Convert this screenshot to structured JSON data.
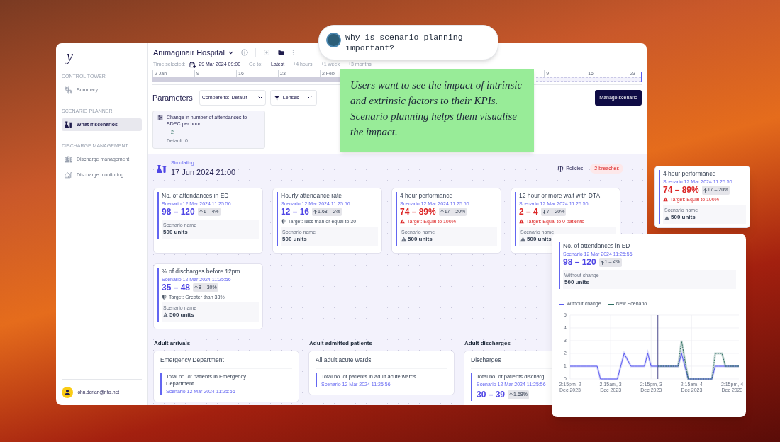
{
  "bubble": {
    "text": "Why is scenario planning important?"
  },
  "note": {
    "text": "Users want to see the impact of intrinsic and extrinsic factors to their KPIs. Scenario planning helps them visualise the impact."
  },
  "sidebar": {
    "logo": "y",
    "sections": [
      {
        "heading": "CONTROL TOWER",
        "items": [
          {
            "label": "Summary",
            "selected": false
          }
        ]
      },
      {
        "heading": "SCENARIO PLANNER",
        "items": [
          {
            "label": "What if scenarios",
            "selected": true
          }
        ]
      },
      {
        "heading": "DISCHARGE MANAGEMENT",
        "items": [
          {
            "label": "Discharge management",
            "selected": false
          },
          {
            "label": "Discharge monitoring",
            "selected": false
          }
        ]
      }
    ],
    "user": {
      "email": "john.dorian@nhs.net"
    }
  },
  "header": {
    "hospital": "Animaginair Hospital"
  },
  "time_bar": {
    "label": "Time selected:",
    "date": "29 Mar 2024 09:00",
    "goto_label": "Go to:",
    "goto_options": [
      {
        "label": "Latest",
        "selected": true
      },
      {
        "label": "+4 hours",
        "selected": false
      },
      {
        "label": "+1 week",
        "selected": false
      },
      {
        "label": "+3 months",
        "selected": false
      }
    ]
  },
  "timeline": {
    "ticks_start": [
      "2 Jan",
      "9",
      "16",
      "23",
      "2 Feb"
    ],
    "ticks_end": [
      "9",
      "16",
      "23"
    ]
  },
  "parameters": {
    "title": "Parameters",
    "compare": {
      "label": "Compare to:",
      "value": "Default"
    },
    "lenses": "Lenses",
    "manage_button": "Manage scenario",
    "items": [
      {
        "label": "Change in number of attendances to SDEC per hour",
        "value": "2",
        "default": "Default: 0"
      }
    ]
  },
  "simulation": {
    "status": "Simulating",
    "date": "17 Jun 2024 21:00",
    "policies": "Policies",
    "breaches": "2 breaches"
  },
  "kpi_cards": [
    {
      "title": "No. of attendances in ED",
      "scenario": "Scenario 12 Mar 2024 11:25:56",
      "value": "98 – 120",
      "breach": false,
      "delta": {
        "down": false,
        "text": "1 – 4%"
      },
      "unit_label": "Scenario name",
      "unit_value": "500 units",
      "warning": false
    },
    {
      "title": "Hourly attendance rate",
      "scenario": "Scenario 12 Mar 2024 11:25:56",
      "value": "12 – 16",
      "breach": false,
      "delta": {
        "down": false,
        "text": "1.68 – 2%"
      },
      "target": {
        "text": "Target: less than or equal to 30",
        "breach": false
      },
      "unit_label": "Scenario name",
      "unit_value": "500 units",
      "warning": false
    },
    {
      "title": "4 hour performance",
      "scenario": "Scenario 12 Mar 2024 11:25:56",
      "value": "74 – 89%",
      "breach": true,
      "delta": {
        "down": false,
        "text": "17 – 20%"
      },
      "target": {
        "text": "Target: Equal to 100%",
        "breach": true
      },
      "unit_label": "Scenario name",
      "unit_value": "500 units",
      "warning": true
    },
    {
      "title": "12 hour or more wait with DTA",
      "scenario": "Scenario 12 Mar 2024 11:25:56",
      "value": "2 – 4",
      "breach": true,
      "delta": {
        "down": true,
        "text": "7 – 20%"
      },
      "target": {
        "text": "Target: Equal to 0 patients",
        "breach": true
      },
      "unit_label": "Scenario name",
      "unit_value": "500 units",
      "warning": true
    },
    {
      "title": "% of discharges before 12pm",
      "scenario": "Scenario 12 Mar 2024 11:25:56",
      "value": "35 – 48",
      "breach": false,
      "delta": {
        "down": false,
        "text": "8 – 30%"
      },
      "target": {
        "text": "Target: Greater than 33%",
        "breach": false
      },
      "unit_label": "Scenario name",
      "unit_value": "500 units",
      "warning": true
    }
  ],
  "sections": [
    {
      "title": "Adult arrivals",
      "card": {
        "title": "Emergency Department",
        "metric": "Total no. of patients in Emergency Department",
        "scenario": "Scenario 12 Mar 2024 11:25:56"
      }
    },
    {
      "title": "Adult admitted patients",
      "card": {
        "title": "All adult acute wards",
        "metric": "Total no. of patients in adult acute wards",
        "scenario": "Scenario 12 Mar 2024 11:25:56"
      }
    },
    {
      "title": "Adult discharges",
      "card": {
        "title": "Discharges",
        "metric": "Total no. of patients discharg",
        "scenario": "Scenario 12 Mar 2024 11:25:56",
        "value": "30 – 39",
        "delta": {
          "down": false,
          "text": "1.68%"
        }
      }
    }
  ],
  "floating_kpi": {
    "title": "4 hour performance",
    "scenario": "Scenario 12 Mar 2024 11:25:56",
    "value": "74 – 89%",
    "breach": true,
    "delta": {
      "down": false,
      "text": "17 – 20%"
    },
    "target": {
      "text": "Target: Equal to 100%",
      "breach": true
    },
    "unit_label": "Scenario name",
    "unit_value": "500 units",
    "warning": true
  },
  "chart_card": {
    "kpi": {
      "title": "No. of attendances in ED",
      "scenario": "Scenario 12 Mar 2024 11:25:56",
      "value": "98 – 120",
      "breach": false,
      "delta": {
        "down": false,
        "text": "1 – 4%"
      },
      "unit_label": "Without change",
      "unit_value": "500 units",
      "warning": false
    },
    "chart_data": {
      "type": "line",
      "categories": [
        "2:15pm, 2 Dec 2023",
        null,
        null,
        null,
        null,
        null,
        null,
        null,
        null,
        null,
        null,
        null,
        "2:15am, 3 Dec 2023",
        null,
        null,
        null,
        null,
        null,
        null,
        null,
        null,
        null,
        null,
        null,
        "2:15pm, 3 Dec 2023",
        null,
        null,
        null,
        null,
        null,
        null,
        null,
        null,
        null,
        null,
        null,
        "2:15am, 4 Dec 2023",
        null,
        null,
        null,
        null,
        null,
        null,
        null,
        null,
        null,
        null,
        null,
        "2:15pm, 4 Dec 2023",
        null,
        null
      ],
      "series": [
        {
          "name": "Without change",
          "color": "#5b5bf0",
          "values": [
            1,
            1,
            1,
            1,
            1,
            1,
            1,
            1,
            1,
            0,
            0,
            0,
            0,
            0,
            0,
            1,
            2,
            1.5,
            1,
            1,
            1,
            1,
            1,
            2,
            1,
            1,
            1,
            1,
            1,
            1,
            1,
            1,
            1,
            2,
            1,
            0,
            0,
            0,
            0,
            0,
            0,
            0,
            0,
            1,
            1,
            1,
            1,
            1,
            1,
            1,
            1
          ]
        },
        {
          "name": "New Scenario",
          "color": "#2f6f62",
          "values": [
            null,
            null,
            null,
            null,
            null,
            null,
            null,
            null,
            null,
            null,
            null,
            null,
            null,
            null,
            null,
            null,
            null,
            null,
            null,
            null,
            null,
            null,
            null,
            null,
            null,
            null,
            1,
            1,
            1,
            1,
            1,
            1,
            1,
            3,
            1.5,
            0,
            0,
            0,
            0,
            0,
            0,
            0,
            0,
            2,
            2,
            2,
            1,
            1,
            1,
            1,
            1
          ]
        }
      ],
      "ylim": [
        0,
        5
      ],
      "yticks": [
        0,
        1,
        2,
        3,
        4,
        5
      ],
      "grid": true
    }
  }
}
